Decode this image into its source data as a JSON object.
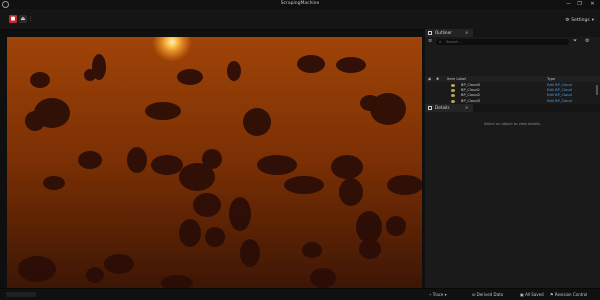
{
  "window": {
    "title": "ScrapingMachine",
    "minimize_glyph": "—",
    "maximize_glyph": "❐",
    "close_glyph": "✕"
  },
  "toolbar": {
    "settings_label": "Settings",
    "settings_icon": "gear-icon"
  },
  "outliner": {
    "tab_label": "Outliner",
    "search_placeholder": "Search...",
    "column_item_label": "Item Label",
    "column_type": "Type",
    "rows": [
      {
        "name": "BP_Cloud0",
        "type": "Edit BP_Cloud"
      },
      {
        "name": "BP_Cloud1",
        "type": "Edit BP_Cloud"
      },
      {
        "name": "BP_Cloud2",
        "type": "Edit BP_Cloud"
      },
      {
        "name": "BP_Cloud3",
        "type": "Edit BP_Cloud"
      },
      {
        "name": "BP_Cloud4",
        "type": "Edit BP_Cloud"
      },
      {
        "name": "BP_Cloud5",
        "type": "Edit BP_Cloud"
      }
    ],
    "status": "170 actors (170 loaded)"
  },
  "details": {
    "tab_label": "Details",
    "empty_message": "Select an object to view details."
  },
  "bottombar": {
    "trace": "Trace",
    "derived_data": "Derived Data",
    "all_saved": "All Saved",
    "revision_control": "Revision Control"
  },
  "colors": {
    "accent_red": "#c0282a",
    "link_blue": "#4ea1e8",
    "sky_orange": "#7a2f04",
    "sun": "#ffd25a",
    "cloud": "#2a0d07"
  }
}
